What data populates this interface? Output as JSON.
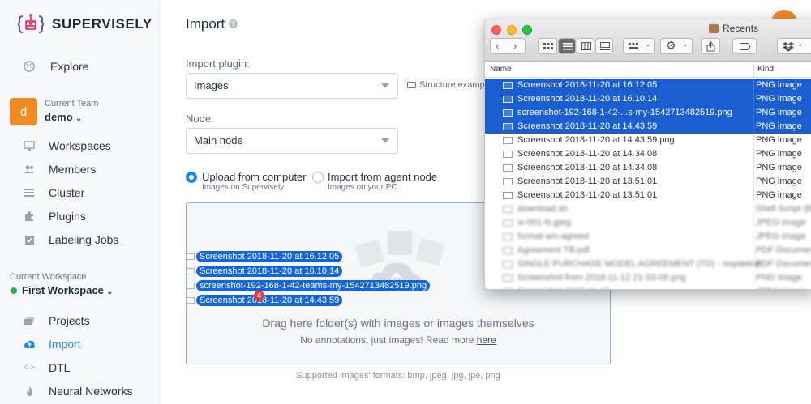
{
  "sidebar": {
    "brand": "SUPERVISELY",
    "explore": "Explore",
    "team_label": "Current Team",
    "team_avatar": "d",
    "team_name": "demo",
    "items": [
      {
        "label": "Workspaces",
        "icon": "monitor-icon"
      },
      {
        "label": "Members",
        "icon": "people-icon"
      },
      {
        "label": "Cluster",
        "icon": "list-icon"
      },
      {
        "label": "Plugins",
        "icon": "puzzle-icon"
      },
      {
        "label": "Labeling Jobs",
        "icon": "clipboard-check-icon"
      }
    ],
    "workspace_label": "Current Workspace",
    "workspace_name": "First Workspace",
    "ws_items": [
      {
        "label": "Projects",
        "icon": "layers-icon"
      },
      {
        "label": "Import",
        "icon": "cloud-upload-icon",
        "active": true
      },
      {
        "label": "DTL",
        "icon": "code-icon"
      },
      {
        "label": "Neural Networks",
        "icon": "flame-icon"
      }
    ],
    "accent": "#1e88e5"
  },
  "main": {
    "title": "Import",
    "plugin_label": "Import plugin:",
    "plugin_value": "Images",
    "structure_link": "Structure examp",
    "node_label": "Node:",
    "node_value": "Main node",
    "radio_upload_title": "Upload from computer",
    "radio_upload_sub": "Images on Supervisely",
    "radio_agent_title": "Import from agent node",
    "radio_agent_sub": "Images on your PC",
    "dropzone_main": "Drag here folder(s) with images or images themselves",
    "dropzone_sub": "No annotations, just images! Read more ",
    "dropzone_link": "here",
    "formats": "Supported images' formats: bmp, jpeg, jpg, jpe, png"
  },
  "drag": {
    "files": [
      "Screenshot 2018-11-20 at 16.12.05",
      "Screenshot 2018-11-20 at 16.10.14",
      "screenshot-192-168-1-42-teams-my-1542713482519.png",
      "Screenshot 2018-11-20 at 14.43.59"
    ],
    "badge": "4"
  },
  "finder": {
    "title": "Recents",
    "col_name": "Name",
    "col_kind": "Kind",
    "rows": [
      {
        "name": "Screenshot 2018-11-20 at 16.12.05",
        "kind": "PNG image",
        "selected": true
      },
      {
        "name": "Screenshot 2018-11-20 at 16.10.14",
        "kind": "PNG image",
        "selected": true
      },
      {
        "name": "screenshot-192-168-1-42-...s-my-1542713482519.png",
        "kind": "PNG image",
        "selected": true
      },
      {
        "name": "Screenshot 2018-11-20 at 14.43.59",
        "kind": "PNG image",
        "selected": true
      },
      {
        "name": "Screenshot 2018-11-20 at 14.43.59.png",
        "kind": "PNG image"
      },
      {
        "name": "Screenshot 2018-11-20 at 14.34.08",
        "kind": "PNG image"
      },
      {
        "name": "Screenshot 2018-11-20 at 14.34.08",
        "kind": "PNG image"
      },
      {
        "name": "Screenshot 2018-11-20 at 13.51.01",
        "kind": "PNG image"
      },
      {
        "name": "Screenshot 2018-11-20 at 13.51.01",
        "kind": "PNG image"
      },
      {
        "name": "download.sh",
        "kind": "Shell Script (B",
        "blurred": true
      },
      {
        "name": "w-001-fs.jpeg",
        "kind": "JPEG image",
        "blurred": true
      },
      {
        "name": "format-am-agreed",
        "kind": "JPEG image",
        "blurred": true
      },
      {
        "name": "Agreement TB.pdf",
        "kind": "PDF Documer",
        "blurred": true
      },
      {
        "name": "SINGLE PURCHASE MODEL AGREEMENT (TD) - nopdekup",
        "kind": "PDF Documer",
        "blurred": true
      },
      {
        "name": "Screenshot from 2018-11-12 21-33-08.png",
        "kind": "PNG image",
        "blurred": true
      },
      {
        "name": "Screenshot 2018-11-15",
        "kind": "JPEG image",
        "blurred": true
      }
    ]
  }
}
